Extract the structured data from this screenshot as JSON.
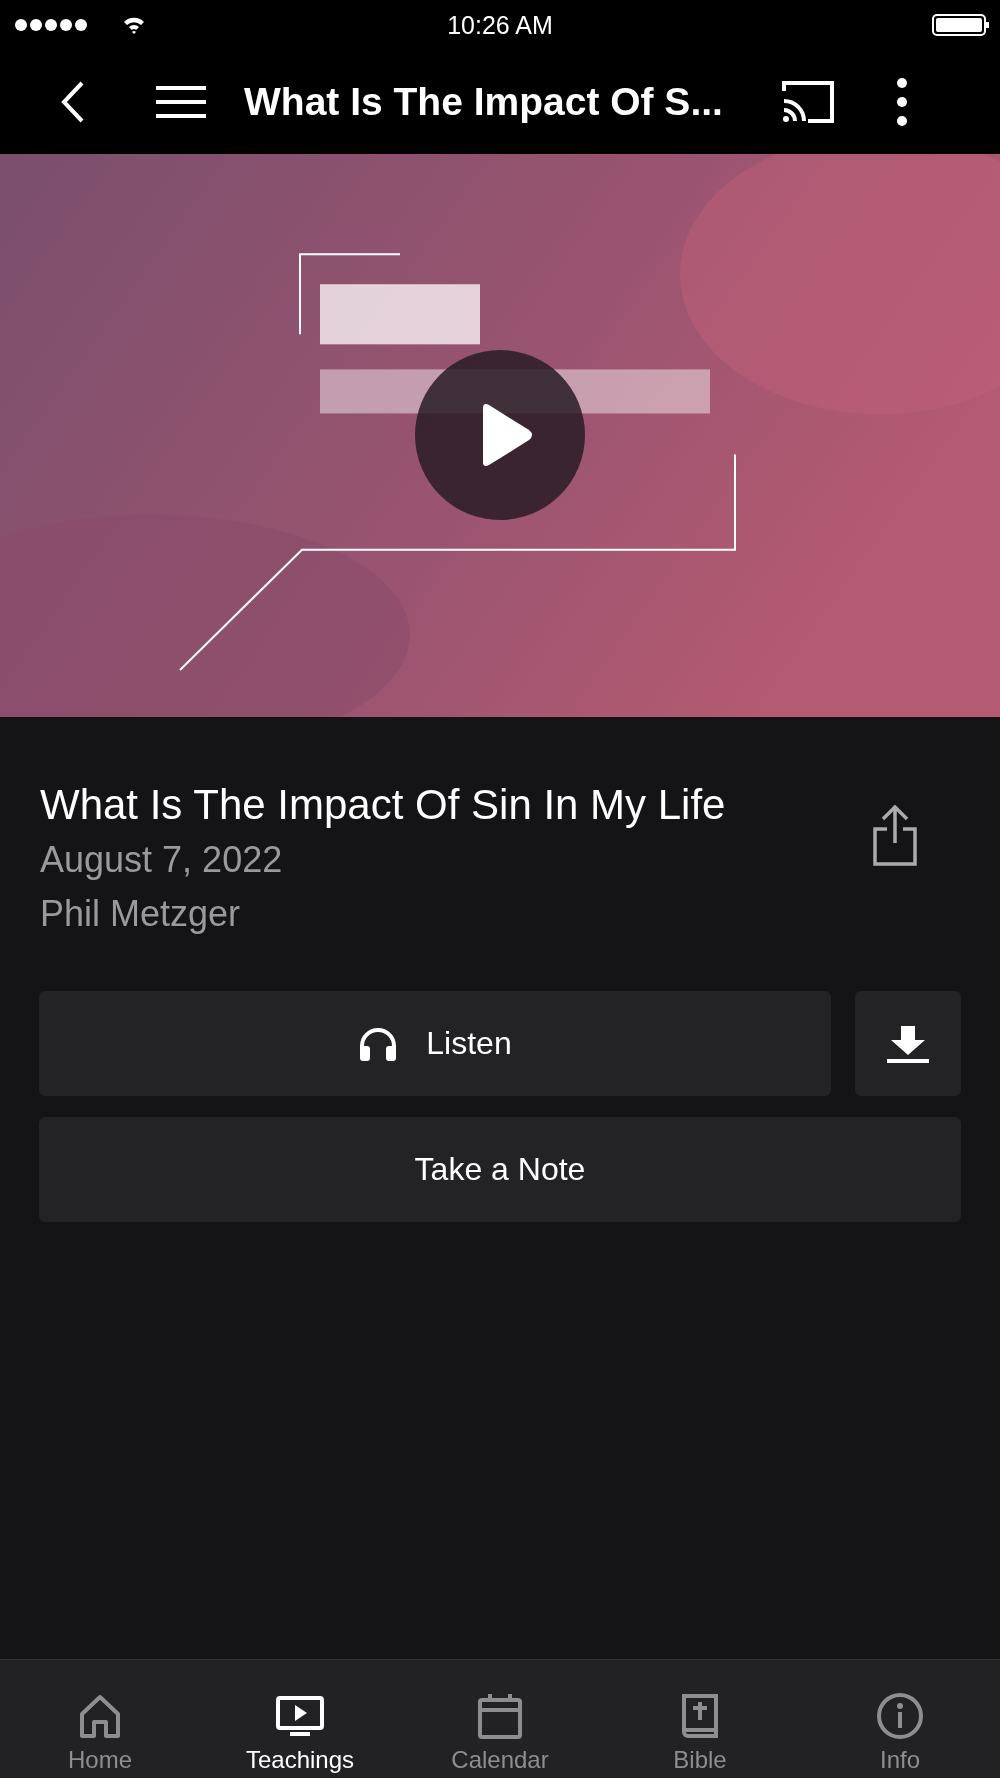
{
  "status_bar": {
    "time": "10:26 AM"
  },
  "nav_bar": {
    "title": "What Is The Impact Of S..."
  },
  "teaching": {
    "title": "What Is The Impact Of Sin In My Life",
    "date": "August 7, 2022",
    "speaker": "Phil Metzger"
  },
  "actions": {
    "listen": "Listen",
    "note": "Take a Note"
  },
  "tabs": [
    {
      "label": "Home",
      "kind": "home",
      "selected": false
    },
    {
      "label": "Teachings",
      "kind": "video",
      "selected": true
    },
    {
      "label": "Calendar",
      "kind": "calendar",
      "selected": false
    },
    {
      "label": "Bible",
      "kind": "bible",
      "selected": false
    },
    {
      "label": "Info",
      "kind": "info",
      "selected": false
    }
  ]
}
